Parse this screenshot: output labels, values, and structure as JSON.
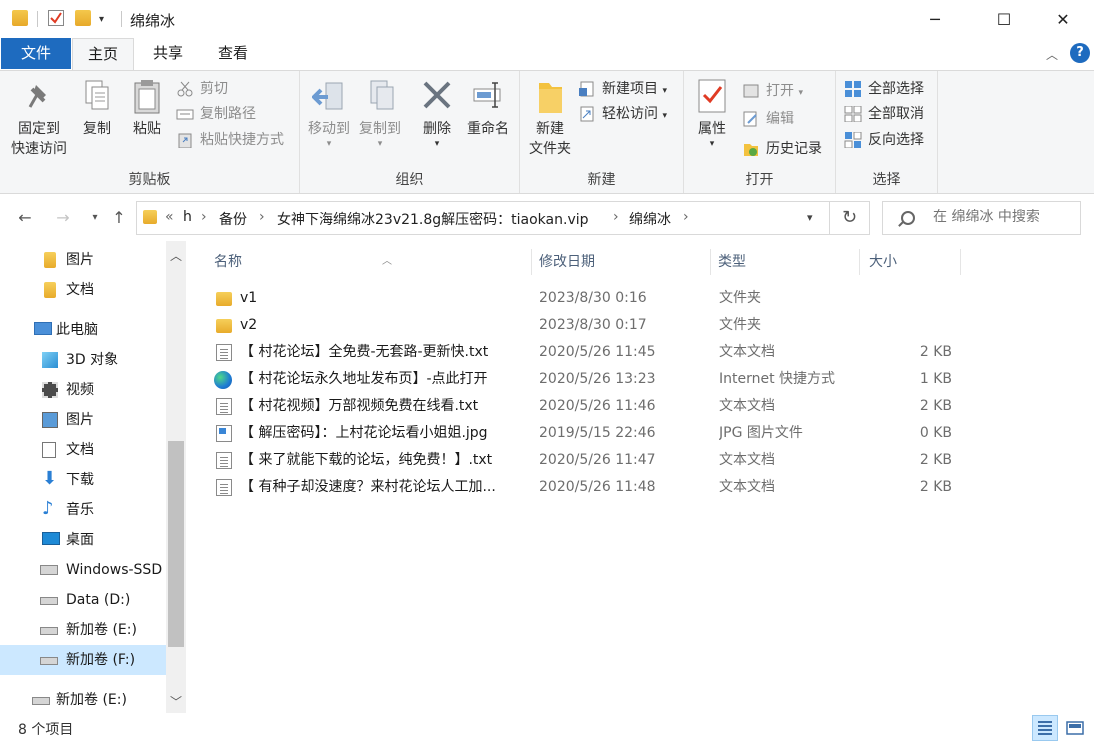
{
  "titlebar": {
    "title": "绵绵冰",
    "quick_access": [
      "folder-icon",
      "properties-check-icon",
      "new-folder-icon",
      "customize-dropdown-icon"
    ],
    "buttons": [
      "─",
      "☐",
      "✕"
    ]
  },
  "ribbon_tabs": {
    "file": "文件",
    "home": "主页",
    "share": "共享",
    "view": "查看"
  },
  "ribbon": {
    "clipboard": {
      "label": "剪贴板",
      "pin_line1": "固定到",
      "pin_line2": "快速访问",
      "copy": "复制",
      "paste": "粘贴",
      "cut": "剪切",
      "copy_path": "复制路径",
      "paste_shortcut": "粘贴快捷方式"
    },
    "organize": {
      "label": "组织",
      "move_to": "移动到",
      "copy_to": "复制到",
      "delete": "删除",
      "rename": "重命名"
    },
    "new": {
      "label": "新建",
      "new_folder_line1": "新建",
      "new_folder_line2": "文件夹",
      "new_item": "新建项目",
      "easy_access": "轻松访问"
    },
    "open": {
      "label": "打开",
      "properties": "属性",
      "open": "打开",
      "edit": "编辑",
      "history": "历史记录"
    },
    "select": {
      "label": "选择",
      "select_all": "全部选择",
      "select_none": "全部取消",
      "invert": "反向选择"
    }
  },
  "navbar": {
    "breadcrumb": [
      "h",
      "备份",
      "女神下海绵绵冰23v21.8g解压密码：tiaokan.vip",
      "绵绵冰"
    ],
    "overflow": "«",
    "search_placeholder": "在 绵绵冰 中搜索"
  },
  "navpane": {
    "items": [
      {
        "label": "图片",
        "icon": "folder-icon"
      },
      {
        "label": "文档",
        "icon": "folder-icon"
      },
      {
        "label": "此电脑",
        "icon": "computer-icon"
      },
      {
        "label": "3D 对象",
        "icon": "3d-objects-icon"
      },
      {
        "label": "视频",
        "icon": "video-icon"
      },
      {
        "label": "图片",
        "icon": "pictures-icon"
      },
      {
        "label": "文档",
        "icon": "documents-icon"
      },
      {
        "label": "下载",
        "icon": "download-icon"
      },
      {
        "label": "音乐",
        "icon": "music-icon"
      },
      {
        "label": "桌面",
        "icon": "desktop-icon"
      },
      {
        "label": "Windows-SSD",
        "icon": "windows-drive-icon"
      },
      {
        "label": "Data (D:)",
        "icon": "drive-icon"
      },
      {
        "label": "新加卷 (E:)",
        "icon": "drive-icon"
      },
      {
        "label": "新加卷 (F:)",
        "icon": "drive-icon"
      },
      {
        "label": "新加卷 (E:)",
        "icon": "drive-icon"
      }
    ]
  },
  "filelist": {
    "columns": {
      "name": "名称",
      "date": "修改日期",
      "type": "类型",
      "size": "大小"
    },
    "rows": [
      {
        "name": "v1",
        "date": "2023/8/30 0:16",
        "type": "文件夹",
        "size": "",
        "icon": "folder-icon"
      },
      {
        "name": "v2",
        "date": "2023/8/30 0:17",
        "type": "文件夹",
        "size": "",
        "icon": "folder-icon"
      },
      {
        "name": "【 村花论坛】全免费-无套路-更新快.txt",
        "date": "2020/5/26 11:45",
        "type": "文本文档",
        "size": "2 KB",
        "icon": "text-file-icon"
      },
      {
        "name": "【 村花论坛永久地址发布页】-点此打开",
        "date": "2020/5/26 13:23",
        "type": "Internet 快捷方式",
        "size": "1 KB",
        "icon": "edge-shortcut-icon"
      },
      {
        "name": "【 村花视频】万部视频免费在线看.txt",
        "date": "2020/5/26 11:46",
        "type": "文本文档",
        "size": "2 KB",
        "icon": "text-file-icon"
      },
      {
        "name": "【 解压密码】：上村花论坛看小姐姐.jpg",
        "date": "2019/5/15 22:46",
        "type": "JPG 图片文件",
        "size": "0 KB",
        "icon": "image-file-icon"
      },
      {
        "name": "【 来了就能下载的论坛，纯免费！】.txt",
        "date": "2020/5/26 11:47",
        "type": "文本文档",
        "size": "2 KB",
        "icon": "text-file-icon"
      },
      {
        "name": "【 有种子却没速度？来村花论坛人工加...",
        "date": "2020/5/26 11:48",
        "type": "文本文档",
        "size": "2 KB",
        "icon": "text-file-icon"
      }
    ]
  },
  "statusbar": {
    "count": "8 个项目"
  }
}
